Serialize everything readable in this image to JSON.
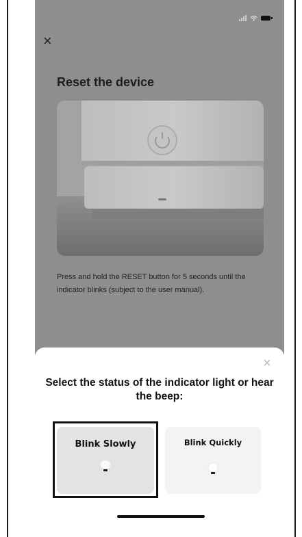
{
  "status_bar": {
    "signal_icon": "signal-icon",
    "wifi_icon": "wifi-icon",
    "battery_icon": "battery-icon"
  },
  "header": {
    "close_glyph": "×",
    "title": "Reset the device"
  },
  "illustration": {
    "icon": "device-power-button-icon"
  },
  "instruction": "Press and hold the RESET button for 5 seconds until the indicator blinks (subject to the user manual).",
  "sheet": {
    "close_glyph": "×",
    "title": "Select the status of the indicator light or hear the beep:",
    "options": [
      {
        "label": "Blink Slowly",
        "icon": "bulb-icon",
        "selected": true
      },
      {
        "label": "Blink Quickly",
        "icon": "bulb-icon",
        "selected": false
      }
    ]
  },
  "colors": {
    "overlay": "#8e8e8e",
    "sheet_bg": "#ffffff",
    "option_selected_bg": "#e3e3e3",
    "option_bg": "#f3f3f3",
    "text": "#111111"
  }
}
